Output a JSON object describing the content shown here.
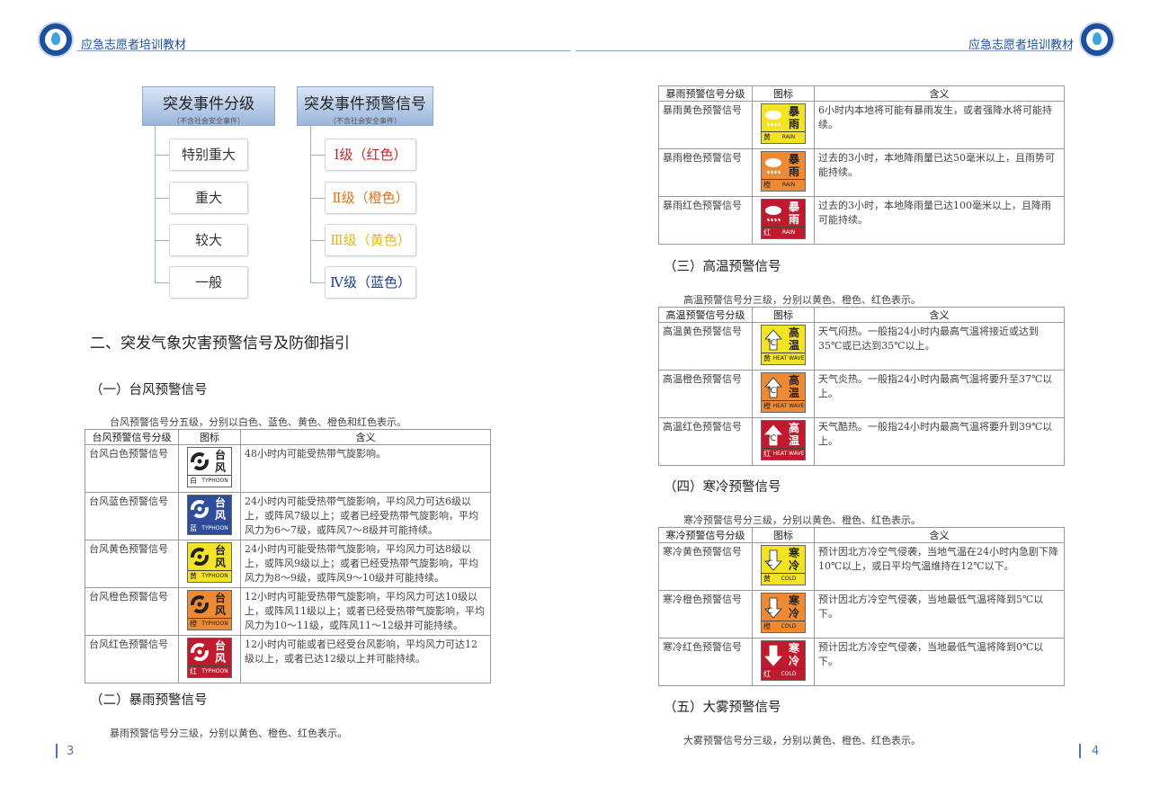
{
  "header": {
    "left_title": "应急志愿者培训教材",
    "right_title": "应急志愿者培训教材"
  },
  "footer": {
    "left_page": "3",
    "right_page": "4"
  },
  "org_chart": {
    "left_head": {
      "title": "突发事件分级",
      "subtitle": "（不含社会安全事件）"
    },
    "right_head": {
      "title": "突发事件预警信号",
      "subtitle": "（不含社会安全事件）"
    },
    "left_items": [
      "特别重大",
      "重大",
      "较大",
      "一般"
    ],
    "right_items": [
      {
        "label": "Ⅰ级（红色）",
        "color": "#c0262d"
      },
      {
        "label": "Ⅱ级（橙色）",
        "color": "#d9731c"
      },
      {
        "label": "Ⅲ级（黄色）",
        "color": "#e3b715"
      },
      {
        "label": "Ⅳ级（蓝色）",
        "color": "#1d3f8f"
      }
    ]
  },
  "section2_title": "二、突发气象灾害预警信号及防御指引",
  "typhoon": {
    "heading": "（一）台风预警信号",
    "intro": "台风预警信号分五级，分别以白色、蓝色、黄色、橙色和红色表示。",
    "columns": [
      "台风预警信号分级",
      "图标",
      "含义"
    ],
    "rows": [
      {
        "name": "台风白色预警信号",
        "icon": {
          "cn1": "台",
          "cn2": "风",
          "lvl": "白",
          "en": "TYPHOON",
          "bg": "#ffffff",
          "fg": "#222222",
          "sym": "typhoon-icon"
        },
        "desc": "48小时内可能受热带气旋影响。"
      },
      {
        "name": "台风蓝色预警信号",
        "icon": {
          "cn1": "台",
          "cn2": "风",
          "lvl": "蓝",
          "en": "TYPHOON",
          "bg": "#2e4e9b",
          "fg": "#ffffff",
          "sym": "typhoon-icon"
        },
        "desc": "24小时内可能受热带气旋影响，平均风力可达6级以上，或阵风7级以上；或者已经受热带气旋影响，平均风力为6～7级，或阵风7～8级并可能持续。"
      },
      {
        "name": "台风黄色预警信号",
        "icon": {
          "cn1": "台",
          "cn2": "风",
          "lvl": "黄",
          "en": "TYPHOON",
          "bg": "#f3e325",
          "fg": "#222222",
          "sym": "typhoon-icon"
        },
        "desc": "24小时内可能受热带气旋影响，平均风力可达8级以上，或阵风9级以上；或者已经受热带气旋影响，平均风力为8～9级，或阵风9～10级并可能持续。"
      },
      {
        "name": "台风橙色预警信号",
        "icon": {
          "cn1": "台",
          "cn2": "风",
          "lvl": "橙",
          "en": "TYPHOON",
          "bg": "#ee8a33",
          "fg": "#222222",
          "sym": "typhoon-icon"
        },
        "desc": "12小时内可能受热带气旋影响，平均风力可达10级以上，或阵风11级以上；或者已经受热带气旋影响，平均风力为10～11级，或阵风11～12级并可能持续。"
      },
      {
        "name": "台风红色预警信号",
        "icon": {
          "cn1": "台",
          "cn2": "风",
          "lvl": "红",
          "en": "TYPHOON",
          "bg": "#c01a2c",
          "fg": "#ffffff",
          "sym": "typhoon-icon"
        },
        "desc": "12小时内可能或者已经受台风影响，平均风力可达12级以上，或者已达12级以上并可能持续。"
      }
    ]
  },
  "rainstorm": {
    "heading": "（二）暴雨预警信号",
    "intro": "暴雨预警信号分三级，分别以黄色、橙色、红色表示。",
    "columns": [
      "暴雨预警信号分级",
      "图标",
      "含义"
    ],
    "rows": [
      {
        "name": "暴雨黄色预警信号",
        "icon": {
          "cn1": "暴",
          "cn2": "雨",
          "lvl": "黄",
          "en": "RAIN STORM",
          "bg": "#f3e325",
          "fg": "#222222",
          "sym": "rain-cloud-icon"
        },
        "desc": "6小时内本地将可能有暴雨发生，或者强降水将可能持续。"
      },
      {
        "name": "暴雨橙色预警信号",
        "icon": {
          "cn1": "暴",
          "cn2": "雨",
          "lvl": "橙",
          "en": "RAIN STORM",
          "bg": "#ee8a33",
          "fg": "#222222",
          "sym": "rain-cloud-icon"
        },
        "desc": "过去的3小时，本地降雨量已达50毫米以上，且雨势可能持续。"
      },
      {
        "name": "暴雨红色预警信号",
        "icon": {
          "cn1": "暴",
          "cn2": "雨",
          "lvl": "红",
          "en": "RAIN STORM",
          "bg": "#c01a2c",
          "fg": "#ffffff",
          "sym": "rain-cloud-icon"
        },
        "desc": "过去的3小时，本地降雨量已达100毫米以上，且降雨可能持续。"
      }
    ]
  },
  "heat": {
    "heading": "（三）高温预警信号",
    "intro": "高温预警信号分三级，分别以黄色、橙色、红色表示。",
    "columns": [
      "高温预警信号分级",
      "图标",
      "含义"
    ],
    "rows": [
      {
        "name": "高温黄色预警信号",
        "icon": {
          "cn1": "高",
          "cn2": "温",
          "lvl": "黄",
          "en": "HEAT WAVE",
          "bg": "#f3e325",
          "fg": "#222222",
          "sym": "thermometer-icon",
          "mark": "℃"
        },
        "desc": "天气闷热。一般指24小时内最高气温将接近或达到35℃或已达到35℃以上。"
      },
      {
        "name": "高温橙色预警信号",
        "icon": {
          "cn1": "高",
          "cn2": "温",
          "lvl": "橙",
          "en": "HEAT WAVE",
          "bg": "#ee8a33",
          "fg": "#222222",
          "sym": "thermometer-icon",
          "mark": "℃"
        },
        "desc": "天气炎热。一般指24小时内最高气温将要升至37℃以上。"
      },
      {
        "name": "高温红色预警信号",
        "icon": {
          "cn1": "高",
          "cn2": "温",
          "lvl": "红",
          "en": "HEAT WAVE",
          "bg": "#c01a2c",
          "fg": "#ffffff",
          "sym": "thermometer-icon",
          "mark": "℃"
        },
        "desc": "天气酷热。一般指24小时内最高气温将要升到39℃以上。"
      }
    ]
  },
  "cold": {
    "heading": "（四）寒冷预警信号",
    "intro": "寒冷预警信号分三级，分别以黄色、橙色、红色表示。",
    "columns": [
      "寒冷预警信号分级",
      "图标",
      "含义"
    ],
    "rows": [
      {
        "name": "寒冷黄色预警信号",
        "icon": {
          "cn1": "寒",
          "cn2": "冷",
          "lvl": "黄",
          "en": "COLD",
          "bg": "#f3e325",
          "fg": "#222222",
          "sym": "cold-arrow-icon",
          "mark": "C"
        },
        "desc": "预计因北方冷空气侵袭，当地气温在24小时内急剧下降10℃以上，或日平均气温维持在12℃以下。"
      },
      {
        "name": "寒冷橙色预警信号",
        "icon": {
          "cn1": "寒",
          "cn2": "冷",
          "lvl": "橙",
          "en": "COLD",
          "bg": "#ee8a33",
          "fg": "#222222",
          "sym": "cold-arrow-icon",
          "mark": "C"
        },
        "desc": "预计因北方冷空气侵袭，当地最低气温将降到5℃以下。"
      },
      {
        "name": "寒冷红色预警信号",
        "icon": {
          "cn1": "寒",
          "cn2": "冷",
          "lvl": "红",
          "en": "COLD",
          "bg": "#c01a2c",
          "fg": "#ffffff",
          "sym": "cold-arrow-icon",
          "mark": ""
        },
        "desc": "预计因北方冷空气侵袭，当地最低气温将降到0℃以下。"
      }
    ]
  },
  "fog": {
    "heading": "（五）大雾预警信号",
    "intro": "大雾预警信号分三级，分别以黄色、橙色、红色表示。"
  }
}
